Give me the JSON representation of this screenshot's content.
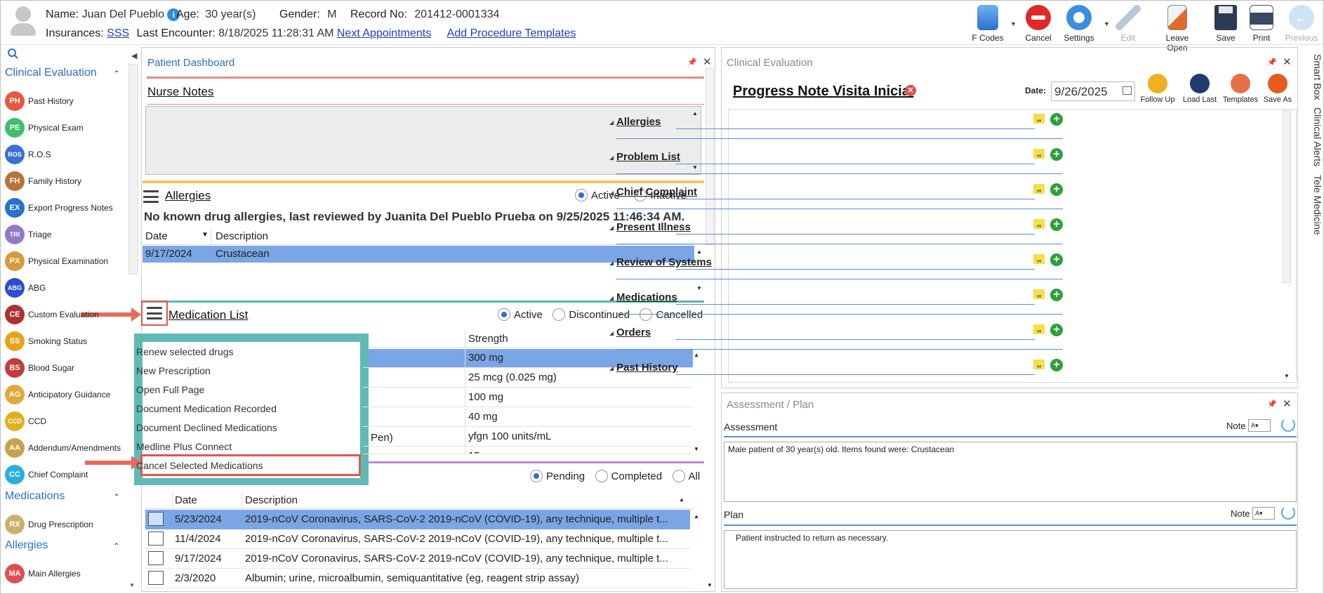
{
  "header": {
    "name_label": "Name:",
    "name_value": "Juan Del Pueblo",
    "age_label": "Age:",
    "age_value": "30 year(s)",
    "gender_label": "Gender:",
    "gender_value": "M",
    "record_label": "Record No:",
    "record_value": "201412-0001334",
    "insurances_label": "Insurances:",
    "insurances_value": "SSS",
    "last_encounter_label": "Last Encounter:",
    "last_encounter_value": "8/18/2025 11:28:31 AM",
    "next_appointments": "Next Appointments",
    "add_procedure_templates": "Add Procedure Templates"
  },
  "toolbar": {
    "fcodes": "F Codes",
    "cancel": "Cancel",
    "settings": "Settings",
    "edit": "Edit",
    "leave_open": "Leave Open",
    "save": "Save",
    "print": "Print",
    "previous": "Previous"
  },
  "sidebar": {
    "section_clinical": "Clinical Evaluation",
    "items": [
      {
        "icon": "PH",
        "label": "Past History",
        "color": "#e8573f"
      },
      {
        "icon": "PE",
        "label": "Physical Exam",
        "color": "#3fbf6a"
      },
      {
        "icon": "ROS",
        "label": "R.O.S",
        "color": "#3b6fd6"
      },
      {
        "icon": "FH",
        "label": "Family History",
        "color": "#b9733a"
      },
      {
        "icon": "EX",
        "label": "Export Progress Notes",
        "color": "#2a6fd1"
      },
      {
        "icon": "TRI",
        "label": "Triage",
        "color": "#8e7bc9"
      },
      {
        "icon": "PX",
        "label": "Physical Examination",
        "color": "#d89a3a"
      },
      {
        "icon": "ABG",
        "label": "ABG",
        "color": "#2a4fd1"
      },
      {
        "icon": "CE",
        "label": "Custom Evaluation",
        "color": "#b03030"
      },
      {
        "icon": "SS",
        "label": "Smoking Status",
        "color": "#e6a317"
      },
      {
        "icon": "BS",
        "label": "Blood Sugar",
        "color": "#c43b3b"
      },
      {
        "icon": "AG",
        "label": "Anticipatory Guidance",
        "color": "#e0a93a"
      },
      {
        "icon": "CCD",
        "label": "CCD",
        "color": "#e0b020"
      },
      {
        "icon": "AA",
        "label": "Addendum/Amendments",
        "color": "#c9a14a"
      },
      {
        "icon": "CC",
        "label": "Chief Complaint",
        "color": "#2aaee0"
      }
    ],
    "section_medications": "Medications",
    "med_items": [
      {
        "icon": "RX",
        "label": "Drug Prescription",
        "color": "#c9b06a"
      }
    ],
    "section_allergies": "Allergies",
    "allergy_items": [
      {
        "icon": "MA",
        "label": "Main Allergies",
        "color": "#e05050"
      }
    ]
  },
  "dashboard": {
    "title": "Patient Dashboard",
    "nurse_notes": "Nurse Notes",
    "allergies_title": "Allergies",
    "allergy_radio_active": "Active",
    "allergy_radio_inactive": "Inactive",
    "allergy_note": "No known drug allergies, last reviewed by Juanita Del Pueblo Prueba on 9/25/2025 11:46:34 AM.",
    "allergy_cols": [
      "Date",
      "Description"
    ],
    "allergy_rows": [
      {
        "date": "9/17/2024",
        "desc": "Crustacean"
      }
    ],
    "med_title": "Medication List",
    "med_radio_active": "Active",
    "med_radio_discontinued": "Discontinued",
    "med_radio_cancelled": "Cancelled",
    "med_col_strength": "Strength",
    "med_strengths": [
      "300 mg",
      "25 mcg (0.025 mg)",
      "100 mg",
      "40 mg",
      "yfgn 100 units/mL",
      "15"
    ],
    "med_partial_desc": "Pen)",
    "context_menu": [
      "Renew selected drugs",
      "New Prescription",
      "Open Full Page",
      "Document Medication Recorded",
      "Document Declined Medications",
      "Medline Plus Connect",
      "Cancel Selected Medications"
    ],
    "orders_radio_pending": "Pending",
    "orders_radio_completed": "Completed",
    "orders_radio_all": "All",
    "orders_cols": [
      "Date",
      "Description"
    ],
    "orders_rows": [
      {
        "date": "5/23/2024",
        "desc": "2019-nCoV Coronavirus, SARS-CoV-2 2019-nCoV (COVID-19), any technique, multiple t..."
      },
      {
        "date": "11/4/2024",
        "desc": "2019-nCoV Coronavirus, SARS-CoV-2 2019-nCoV (COVID-19), any technique, multiple t..."
      },
      {
        "date": "9/17/2024",
        "desc": "2019-nCoV Coronavirus, SARS-CoV-2 2019-nCoV (COVID-19), any technique, multiple t..."
      },
      {
        "date": "2/3/2020",
        "desc": "Albumin; urine, microalbumin, semiquantitative (eg, reagent strip assay)"
      }
    ]
  },
  "clinical_eval": {
    "title": "Clinical Evaluation",
    "note_title": "Progress Note Visita Inicial",
    "date_label": "Date:",
    "date_value": "9/26/2025",
    "follow_up": "Follow Up",
    "load_last": "Load Last",
    "templates": "Templates",
    "save_as": "Save As",
    "sections": [
      "Allergies",
      "Problem List",
      "Chief Complaint",
      "Present Illness",
      "Review of Systems",
      "Medications",
      "Orders",
      "Past History"
    ]
  },
  "assessment": {
    "title": "Assessment / Plan",
    "assessment_label": "Assessment",
    "note_label": "Note",
    "assessment_text": "Male patient of 30 year(s) old. Items found were:  Crustacean",
    "plan_label": "Plan",
    "plan_text": "Patient instructed to return as necessary."
  },
  "right_tabs": [
    "Smart Box",
    "Clinical Alerts",
    "Tele Medicine"
  ]
}
